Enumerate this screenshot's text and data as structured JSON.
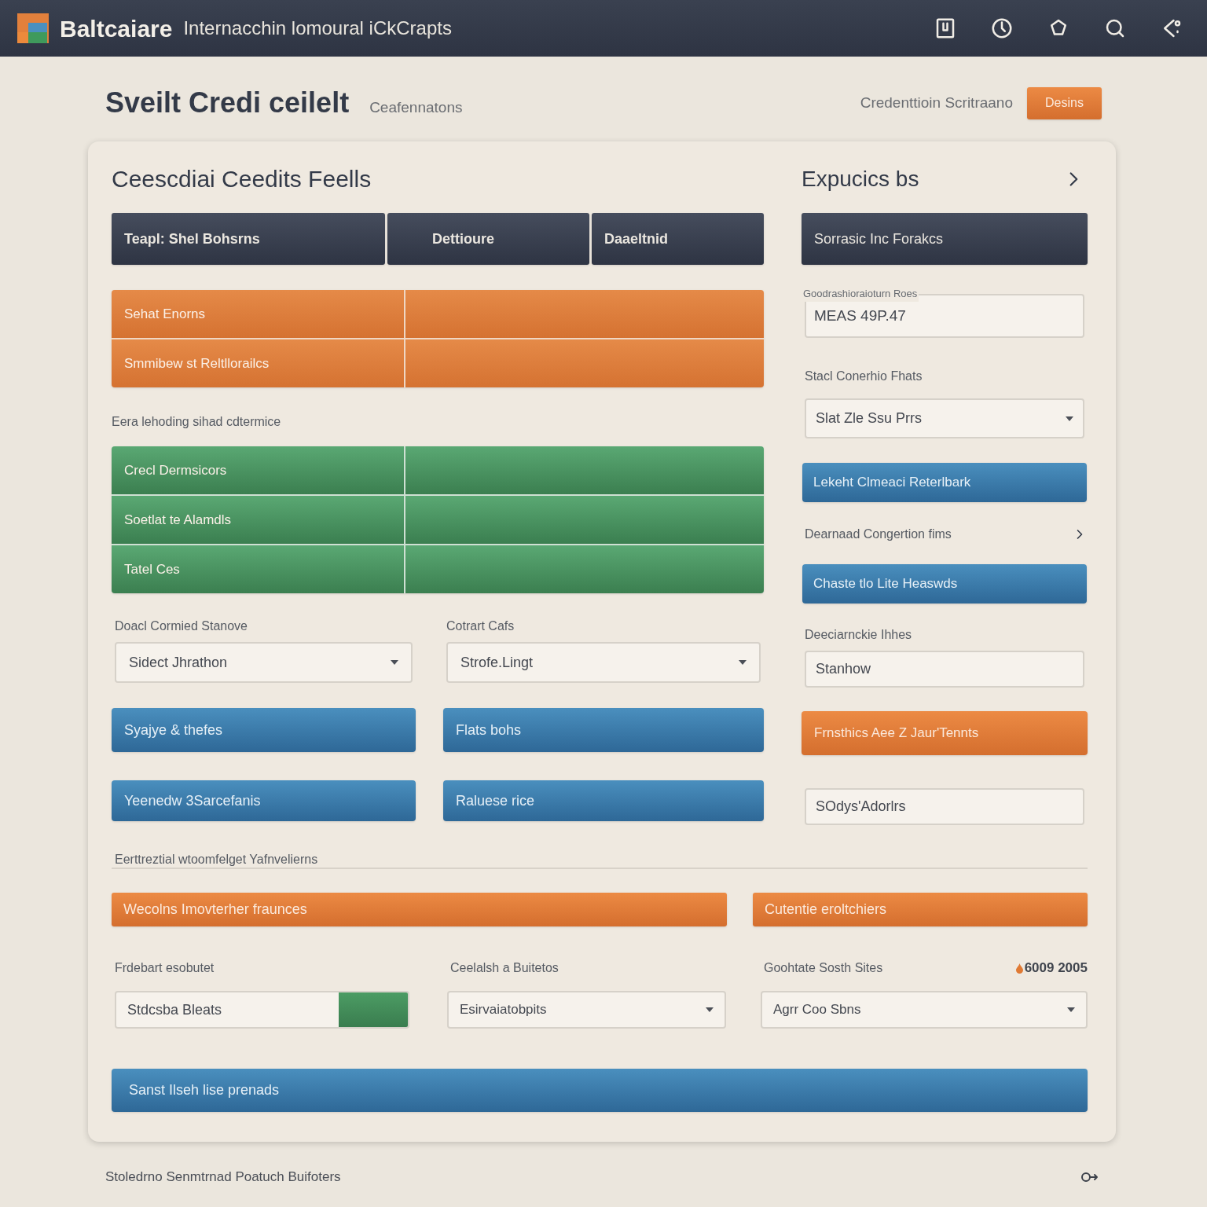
{
  "header": {
    "brand": "Baltcaiare",
    "subtitle": "Internacchin lomoural iCkCrapts"
  },
  "page": {
    "title": "Sveilt Credi ceilelt",
    "subtitle": "Ceafennatons",
    "meta": "Credenttioin Scritraano",
    "action": "Desins"
  },
  "left": {
    "title": "Ceescdiai Ceedits Feells",
    "header_cells": [
      "Teapl: Shel Bohsrns",
      "Dettioure",
      "Daaeltnid"
    ],
    "orange_rows": [
      "Sehat Enorns",
      "Smmibew st Reltllorailcs"
    ],
    "caption": "Eera lehoding sihad cdtermice",
    "green_rows": [
      "Crecl Dermsicors",
      "Soetlat te Alamdls",
      "Tatel Ces"
    ],
    "form_columns": [
      {
        "label": "Doacl Cormied Stanove",
        "select": "Sidect Jhrathon",
        "buttons": [
          "Syajye & thefes",
          "Yeenedw 3Sarcefanis"
        ]
      },
      {
        "label": "Cotrart Cafs",
        "select": "Strofe.Lingt",
        "buttons": [
          "Flats bohs",
          "Raluese rice"
        ]
      }
    ]
  },
  "right": {
    "title": "Expucics bs",
    "bar": "Sorrasic Inc Forakcs",
    "items": [
      {
        "kind": "outlined_field",
        "label": "Goodrashioraioturn Roes",
        "value": "MEAS 49P.47"
      },
      {
        "kind": "select",
        "label": "Stacl Conerhio Fhats",
        "value": "Slat Zle Ssu Prrs"
      },
      {
        "kind": "blue_button",
        "label": "Lekeht Clmeaci Reterlbark"
      },
      {
        "kind": "link",
        "label": "Dearnaad Congertion fims"
      },
      {
        "kind": "blue_button",
        "label": "Chaste tlo Lite Heaswds"
      },
      {
        "kind": "field",
        "label": "Deeciarnckie Ihhes",
        "value": "Stanhow"
      },
      {
        "kind": "orange_button",
        "label": "Frnsthics Aee Z Jaur'Tennts"
      },
      {
        "kind": "field",
        "value": "SOdys'Adorlrs"
      }
    ]
  },
  "bottom": {
    "caption": "Eerttreztial wtoomfelget Yafnvelierns",
    "bars": [
      "Wecolns Imovterher fraunces",
      "Cutentie eroltchiers"
    ],
    "controls": [
      {
        "kind": "combo_input",
        "label": "Frdebart esobutet",
        "value": "Stdcsba Bleats"
      },
      {
        "kind": "select",
        "label": "Ceelalsh a Buitetos",
        "value": "Esirvaiatobpits"
      },
      {
        "kind": "select",
        "label": "Goohtate Sosth Sites",
        "extra": "6009 2005",
        "value": "Agrr Coo Sbns"
      }
    ],
    "button": "Sanst Ilseh lise prenads"
  },
  "footer": {
    "text": "Stoledrno Senmtrnad Poatuch Buifoters"
  }
}
